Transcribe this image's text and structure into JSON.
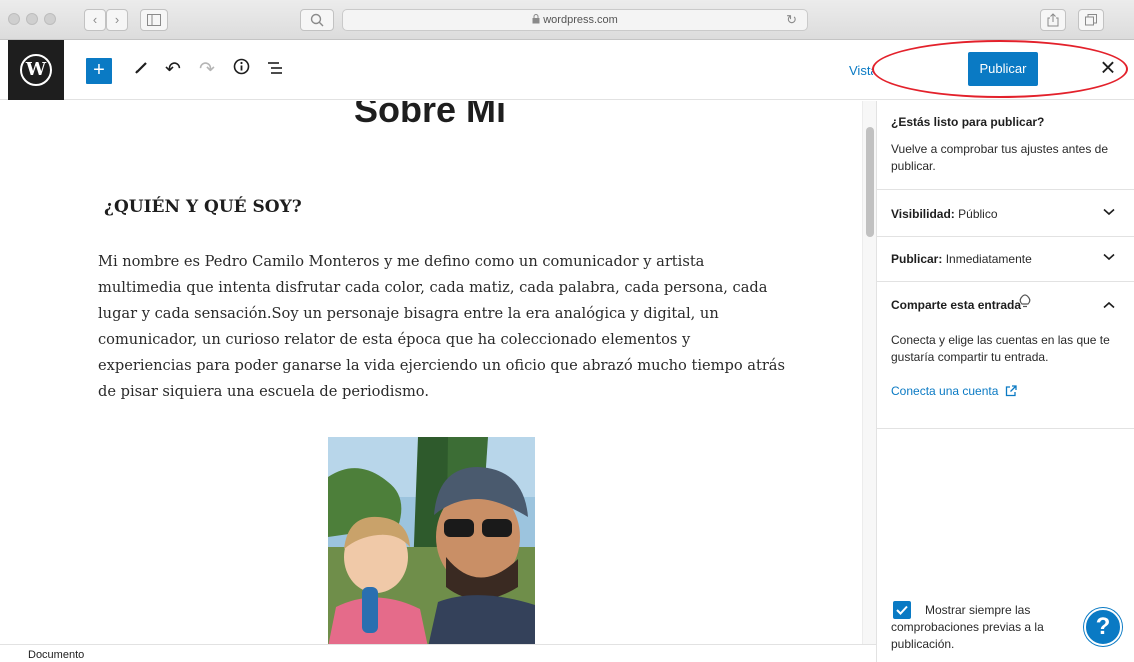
{
  "browser": {
    "url": "wordpress.com",
    "back_glyph": "‹",
    "forward_glyph": "›",
    "reload_glyph": "↻"
  },
  "toolbar": {
    "add_glyph": "+",
    "undo_glyph": "↶",
    "redo_glyph": "↷",
    "info_glyph": "ⓘ",
    "outline_glyph": "☰",
    "tools_glyph": "✎",
    "preview_label": "Vista previa",
    "publish_label": "Publicar",
    "close_glyph": "×",
    "logo_letter": "W"
  },
  "post": {
    "title": "Sobre Mí",
    "heading": "¿QUIÉN  Y QUÉ SOY?",
    "paragraph": "Mi nombre es Pedro Camilo Monteros y me defino como un comunicador y artista multimedia que intenta disfrutar cada color, cada matiz, cada palabra, cada persona, cada lugar y cada sensación.Soy un personaje bisagra entre la era analógica y digital, un comunicador, un curioso relator de esta época que ha coleccionado elementos y experiencias para poder ganarse la vida ejerciendo un oficio que abrazó mucho tiempo atrás de pisar siquiera una escuela de periodismo."
  },
  "sidebar": {
    "ready_question": "¿Estás listo para publicar?",
    "ready_description": "Vuelve a comprobar tus ajustes antes de publicar.",
    "visibility_label": "Visibilidad:",
    "visibility_value": "Público",
    "publish_label": "Publicar:",
    "publish_value": "Inmediatamente",
    "share_title": "Comparte esta entrada",
    "share_description": "Conecta y elige las cuentas en las que te gustaría compartir tu entrada.",
    "share_link": "Conecta una cuenta",
    "checkbox_label": "Mostrar siempre las comprobaciones previas a la publicación.",
    "chevron_down": "⌄",
    "chevron_up": "⌃",
    "help_glyph": "?"
  },
  "footer": {
    "breadcrumb": "Documento"
  },
  "colors": {
    "accent": "#0a7ac4",
    "highlight": "#e3212b",
    "logo_bg": "#1e1e1e"
  }
}
